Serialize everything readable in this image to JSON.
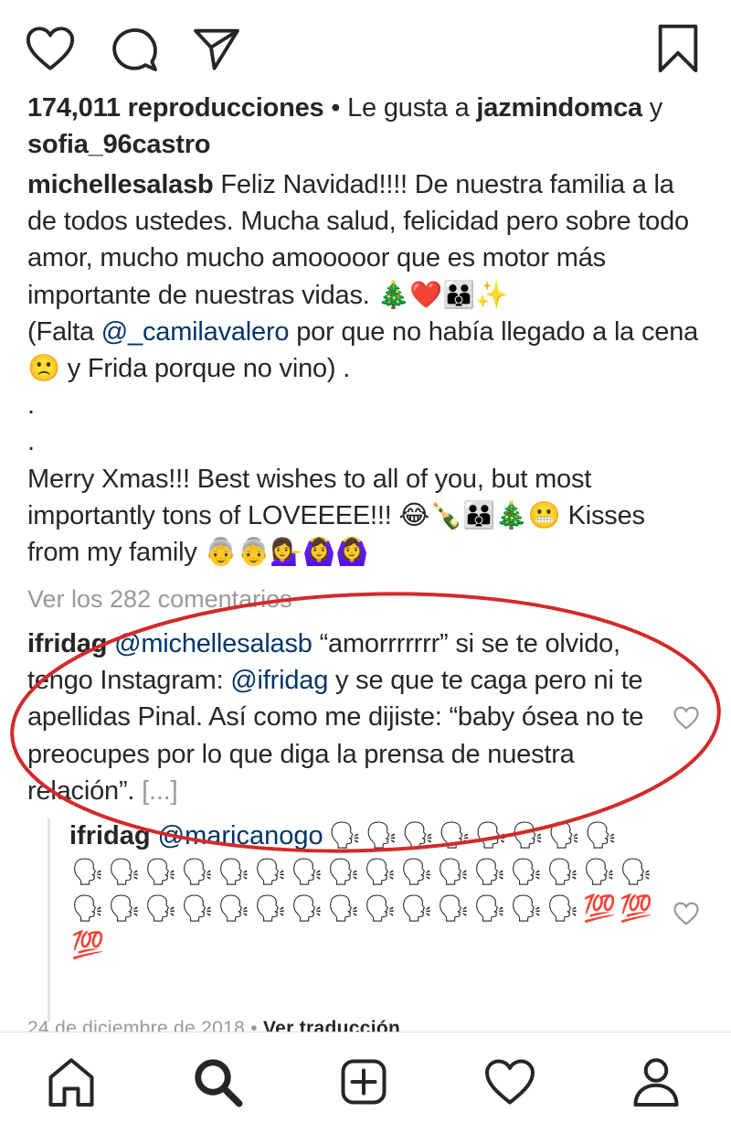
{
  "actions": {
    "like_icon": "heart-outline-icon",
    "comment_icon": "comment-bubble-icon",
    "share_icon": "paper-plane-icon",
    "save_icon": "bookmark-icon"
  },
  "likes": {
    "views": "174,011 reproducciones",
    "separator": " • Le gusta a ",
    "user1": "jazmindomca",
    "conj": " y",
    "user2": "sofia_96castro"
  },
  "caption": {
    "author": "michellesalasb",
    "line1": " Feliz Navidad!!!! De nuestra familia a la de todos ustedes. Mucha salud, felicidad pero sobre todo amor, mucho mucho amooooor que es motor más importante de nuestras vidas. 🎄❤️👪✨",
    "line2_prefix": "(Falta ",
    "mention": "@_camilavalero",
    "line2_suffix": " por que no había llegado a la cena 🙁 y Frida porque no vino) .",
    "dot1": ".",
    "dot2": ".",
    "english": "Merry Xmas!!! Best wishes to all of you, but most importantly tons of LOVEEEE!!! 😂🍾👪🎄😬 Kisses from my family 👵👵💁‍♀️🙆‍♀️🙆‍♀️"
  },
  "view_comments": "Ver los 282 comentarios",
  "comment": {
    "author": "ifridag",
    "mention1": "@michellesalasb",
    "text1": " “amorrrrrrr” si se te olvido, tengo Instagram: ",
    "mention2": "@ifridag",
    "text2": " y se que te caga pero ni te apellidas Pinal. Así como me dijiste: “baby ósea no te preocupes por lo que diga la prensa de nuestra relación”. ",
    "more": "[...]"
  },
  "reply": {
    "author": "ifridag",
    "mention": "@maricanogo",
    "emoji": "🗣",
    "hundred": "💯"
  },
  "timestamp": {
    "date": "24 de diciembre de 2018 • ",
    "translate": "Ver traducción"
  },
  "nav": [
    "home-icon",
    "search-icon",
    "new-post-icon",
    "activity-heart-icon",
    "profile-icon"
  ],
  "colors": {
    "mention": "#003569",
    "muted": "#999999",
    "annotation": "#d42a2a"
  }
}
